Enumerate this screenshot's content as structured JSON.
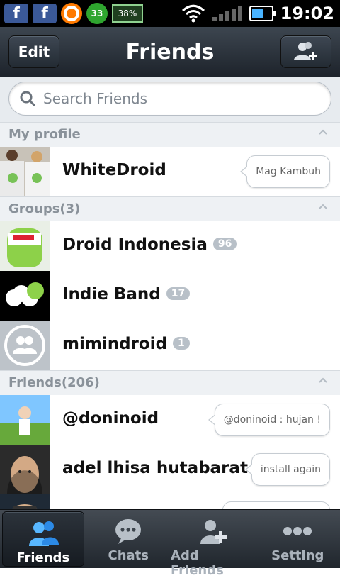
{
  "status_bar": {
    "time": "19:02",
    "battery_badge_text": "38%",
    "green_badge_text": "33",
    "left_icons": [
      "facebook-icon",
      "facebook-icon",
      "orange-ring-icon",
      "green-counter-icon",
      "battery-small-icon"
    ],
    "right_icons": [
      "wifi-icon",
      "signal-icon",
      "battery-icon"
    ]
  },
  "header": {
    "title": "Friends",
    "left_button": "Edit",
    "right_button_icon": "add-friend-icon"
  },
  "search": {
    "placeholder": "Search Friends"
  },
  "sections": {
    "my_profile": "My profile",
    "groups": "Groups(3)",
    "friends": "Friends(206)"
  },
  "profile": {
    "name": "WhiteDroid",
    "status": "Mag Kambuh"
  },
  "groups": [
    {
      "name": "Droid Indonesia",
      "count": "96"
    },
    {
      "name": "Indie Band",
      "count": "17"
    },
    {
      "name": "mimindroid",
      "count": "1"
    }
  ],
  "friends": [
    {
      "name": "@doninoid",
      "status": "@doninoid : hujan !"
    },
    {
      "name": "adel lhisa hutabarat",
      "status": "install again"
    }
  ],
  "tabs": [
    {
      "label": "Friends",
      "icon": "friends-icon"
    },
    {
      "label": "Chats",
      "icon": "chat-bubble-icon"
    },
    {
      "label": "Add Friends",
      "icon": "add-friend-icon"
    },
    {
      "label": "Setting",
      "icon": "more-dots-icon"
    }
  ],
  "colors": {
    "header_bg": "#2b323a",
    "section_bg": "#eef1f4",
    "badge_bg": "#b8c0c8",
    "tab_active_icon": "#3ea0ff"
  }
}
